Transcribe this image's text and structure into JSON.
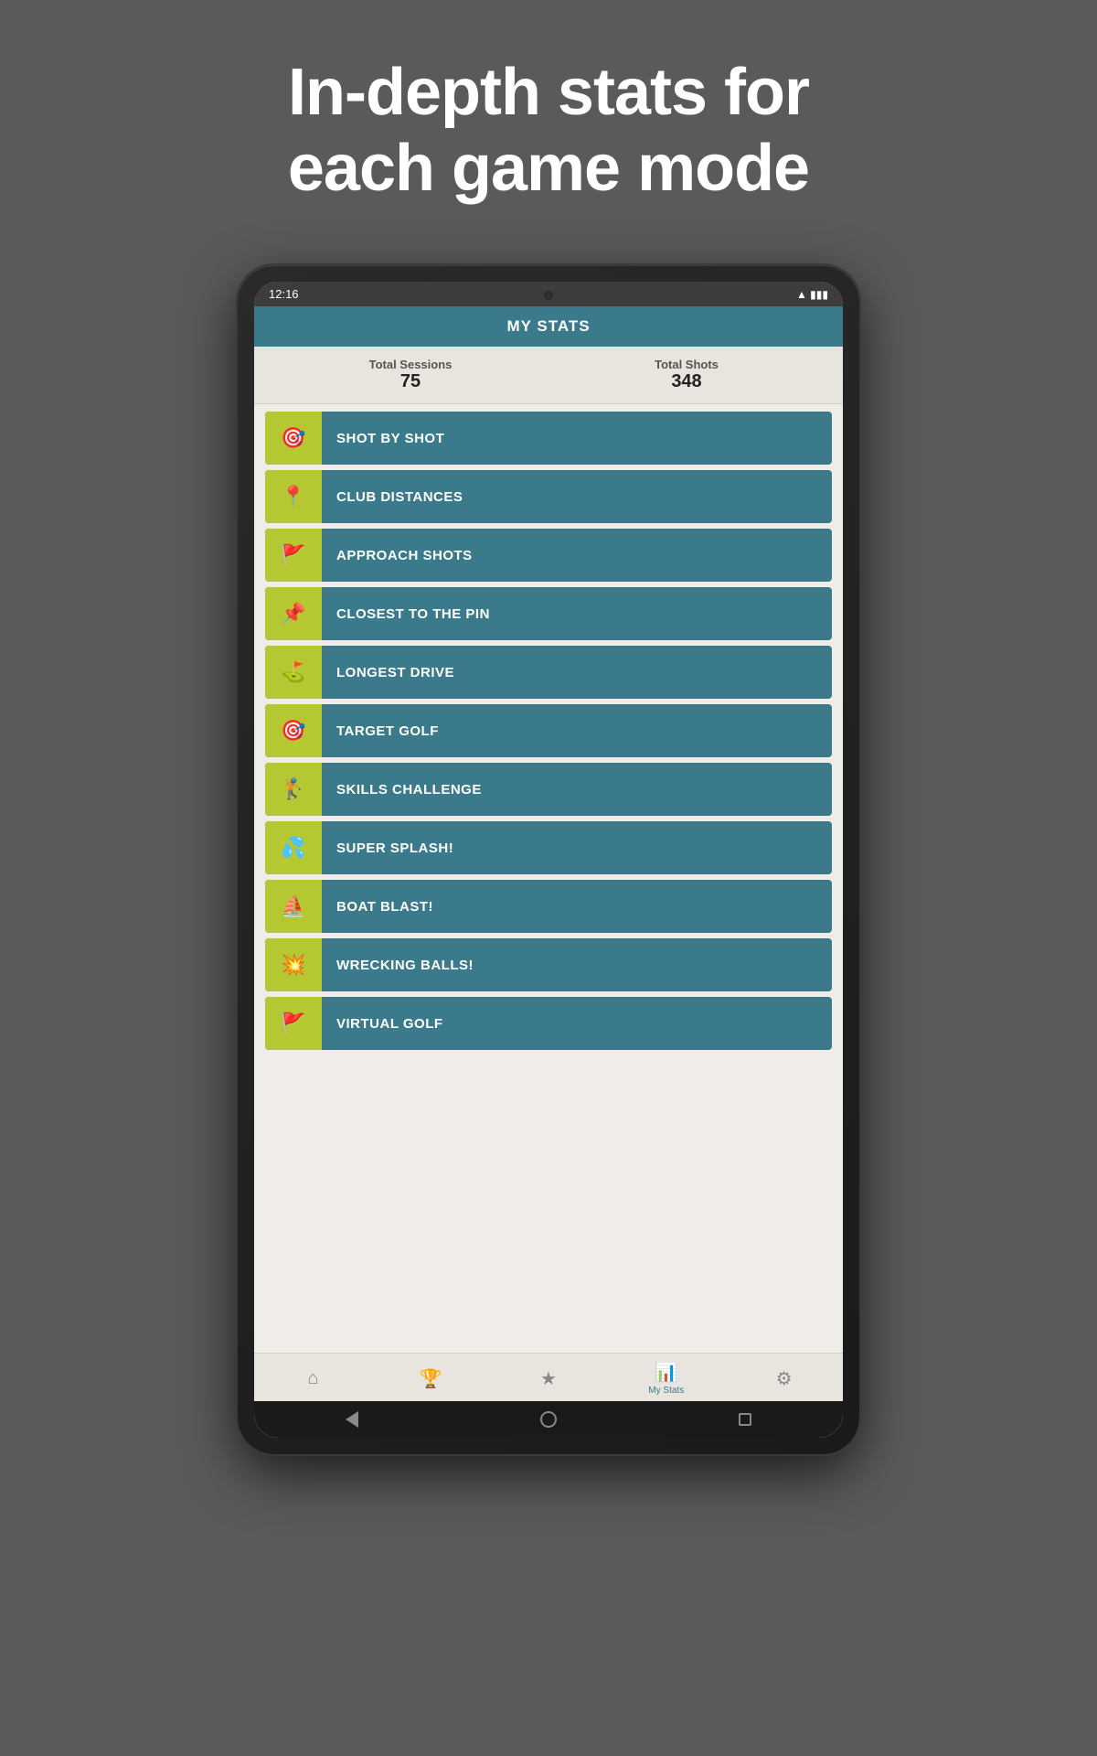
{
  "page": {
    "headline_line1": "In-depth stats for",
    "headline_line2": "each game mode",
    "background_color": "#5a5a5a"
  },
  "status_bar": {
    "time": "12:16",
    "icons": "▼ ▲ 4",
    "battery": "🔋"
  },
  "app_bar": {
    "title": "MY STATS"
  },
  "stats_summary": {
    "sessions_label": "Total Sessions",
    "sessions_value": "75",
    "shots_label": "Total Shots",
    "shots_value": "348"
  },
  "game_modes": [
    {
      "id": "shot-by-shot",
      "label": "SHOT BY SHOT",
      "icon": "🎯"
    },
    {
      "id": "club-distances",
      "label": "CLUB DISTANCES",
      "icon": "📍"
    },
    {
      "id": "approach-shots",
      "label": "APPROACH SHOTS",
      "icon": "🚩"
    },
    {
      "id": "closest-to-pin",
      "label": "CLOSEST TO THE PIN",
      "icon": "📌"
    },
    {
      "id": "longest-drive",
      "label": "LONGEST DRIVE",
      "icon": "⛳"
    },
    {
      "id": "target-golf",
      "label": "TARGET GOLF",
      "icon": "🎯"
    },
    {
      "id": "skills-challenge",
      "label": "SKILLS CHALLENGE",
      "icon": "🏌"
    },
    {
      "id": "super-splash",
      "label": "SUPER SPLASH!",
      "icon": "💦"
    },
    {
      "id": "boat-blast",
      "label": "BOAT BLAST!",
      "icon": "⛵"
    },
    {
      "id": "wrecking-balls",
      "label": "WRECKING BALLS!",
      "icon": "💥"
    },
    {
      "id": "virtual-golf",
      "label": "VIRTUAL GOLF",
      "icon": "🚩"
    }
  ],
  "bottom_nav": [
    {
      "id": "home",
      "icon": "⌂",
      "label": ""
    },
    {
      "id": "trophy",
      "icon": "🏆",
      "label": ""
    },
    {
      "id": "star",
      "icon": "★",
      "label": ""
    },
    {
      "id": "stats",
      "icon": "📊",
      "label": "My Stats",
      "active": true
    },
    {
      "id": "settings",
      "icon": "⚙",
      "label": ""
    }
  ],
  "colors": {
    "teal": "#3a7a8a",
    "lime": "#b5c832",
    "background": "#f0ede8",
    "dark": "#1a1a1a"
  }
}
